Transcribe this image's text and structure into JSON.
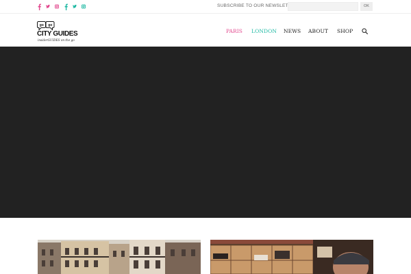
{
  "colors": {
    "paris_pink": "#e2488e",
    "london_teal": "#1fb9a3",
    "nav_text": "#222222",
    "hero_bg": "#222222"
  },
  "social": [
    {
      "name": "facebook",
      "icon": "facebook-icon"
    },
    {
      "name": "twitter",
      "icon": "twitter-icon"
    },
    {
      "name": "instagram",
      "icon": "instagram-icon"
    },
    {
      "name": "facebook",
      "icon": "facebook-icon"
    },
    {
      "name": "twitter",
      "icon": "twitter-icon"
    },
    {
      "name": "instagram",
      "icon": "instagram-icon"
    }
  ],
  "newsletter": {
    "label": "SUBSCRIBE TO OUR NEWSLETTER",
    "placeholder": "",
    "button": "OK"
  },
  "logo": {
    "bubble_1": "go",
    "bubble_2": "go",
    "main": "CITY GUIDES",
    "sub": "insiderGUIDES on the go"
  },
  "nav": {
    "paris": "PARIS",
    "london": "LONDON",
    "news": "NEWS",
    "about": "ABOUT",
    "shop": "SHOP"
  }
}
